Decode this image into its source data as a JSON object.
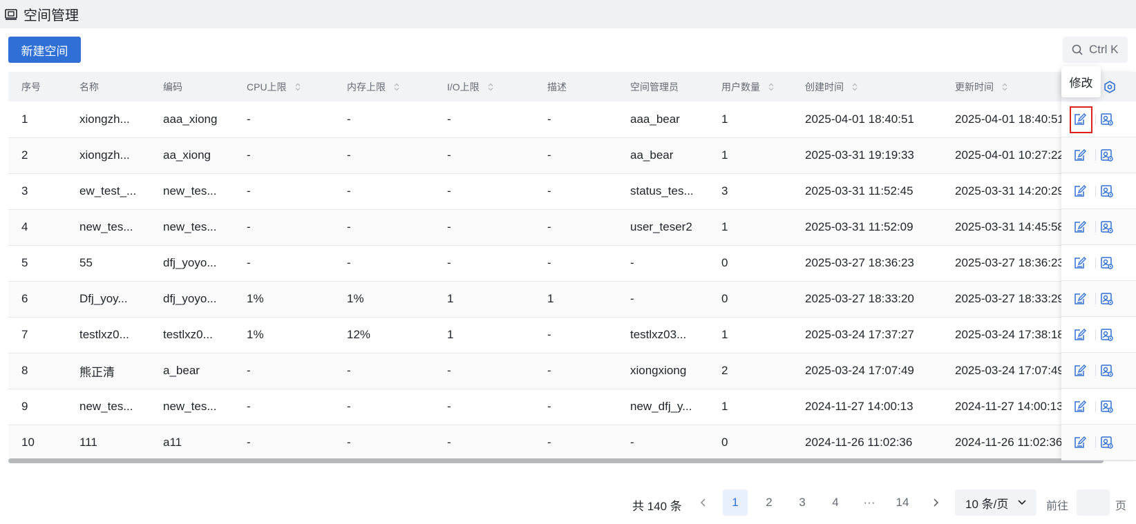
{
  "header": {
    "title": "空间管理",
    "icon": "space-box-icon"
  },
  "toolbar": {
    "new_label": "新建空间",
    "search_shortcut": "Ctrl K",
    "search_icon": "search-icon"
  },
  "table": {
    "columns": [
      "序号",
      "名称",
      "编码",
      "CPU上限",
      "内存上限",
      "I/O上限",
      "描述",
      "空间管理员",
      "用户数量",
      "创建时间",
      "更新时间"
    ],
    "rows": [
      [
        "1",
        "xiongzh...",
        "aaa_xiong",
        "-",
        "-",
        "-",
        "-",
        "aaa_bear",
        "1",
        "2025-04-01 18:40:51",
        "2025-04-01 18:40:51"
      ],
      [
        "2",
        "xiongzh...",
        "aa_xiong",
        "-",
        "-",
        "-",
        "-",
        "aa_bear",
        "1",
        "2025-03-31 19:19:33",
        "2025-04-01 10:27:22"
      ],
      [
        "3",
        "ew_test_...",
        "new_tes...",
        "-",
        "-",
        "-",
        "-",
        "status_tes...",
        "3",
        "2025-03-31 11:52:45",
        "2025-03-31 14:20:29"
      ],
      [
        "4",
        "new_tes...",
        "new_tes...",
        "-",
        "-",
        "-",
        "-",
        "user_teser2",
        "1",
        "2025-03-31 11:52:09",
        "2025-03-31 14:45:58"
      ],
      [
        "5",
        "55",
        "dfj_yoyo...",
        "-",
        "-",
        "-",
        "-",
        "-",
        "0",
        "2025-03-27 18:36:23",
        "2025-03-27 18:36:23"
      ],
      [
        "6",
        "Dfj_yoy...",
        "dfj_yoyo...",
        "1%",
        "1%",
        "1",
        "1",
        "-",
        "0",
        "2025-03-27 18:33:20",
        "2025-03-27 18:33:29"
      ],
      [
        "7",
        "testlxz0...",
        "testlxz0...",
        "1%",
        "12%",
        "1",
        "-",
        "testlxz03...",
        "1",
        "2025-03-24 17:37:27",
        "2025-03-24 17:38:18"
      ],
      [
        "8",
        "熊正清",
        "a_bear",
        "-",
        "-",
        "-",
        "-",
        "xiongxiong",
        "2",
        "2025-03-24 17:07:49",
        "2025-03-24 17:07:49"
      ],
      [
        "9",
        "new_tes...",
        "new_tes...",
        "-",
        "-",
        "-",
        "-",
        "new_dfj_y...",
        "1",
        "2024-11-27 14:00:13",
        "2024-11-27 14:00:13"
      ],
      [
        "10",
        "111",
        "a11",
        "-",
        "-",
        "-",
        "-",
        "-",
        "0",
        "2024-11-26 11:02:36",
        "2024-11-26 11:02:36"
      ]
    ]
  },
  "tooltip": {
    "text": "修改"
  },
  "pagination": {
    "total_text": "共 140 条",
    "pages": [
      "1",
      "2",
      "3",
      "4",
      "···",
      "14"
    ],
    "current": "1",
    "page_size": "10 条/页",
    "goto_label": "前往",
    "page_suffix": "页"
  },
  "colors": {
    "primary": "#2f6fd6",
    "highlight": "#e0201b"
  }
}
